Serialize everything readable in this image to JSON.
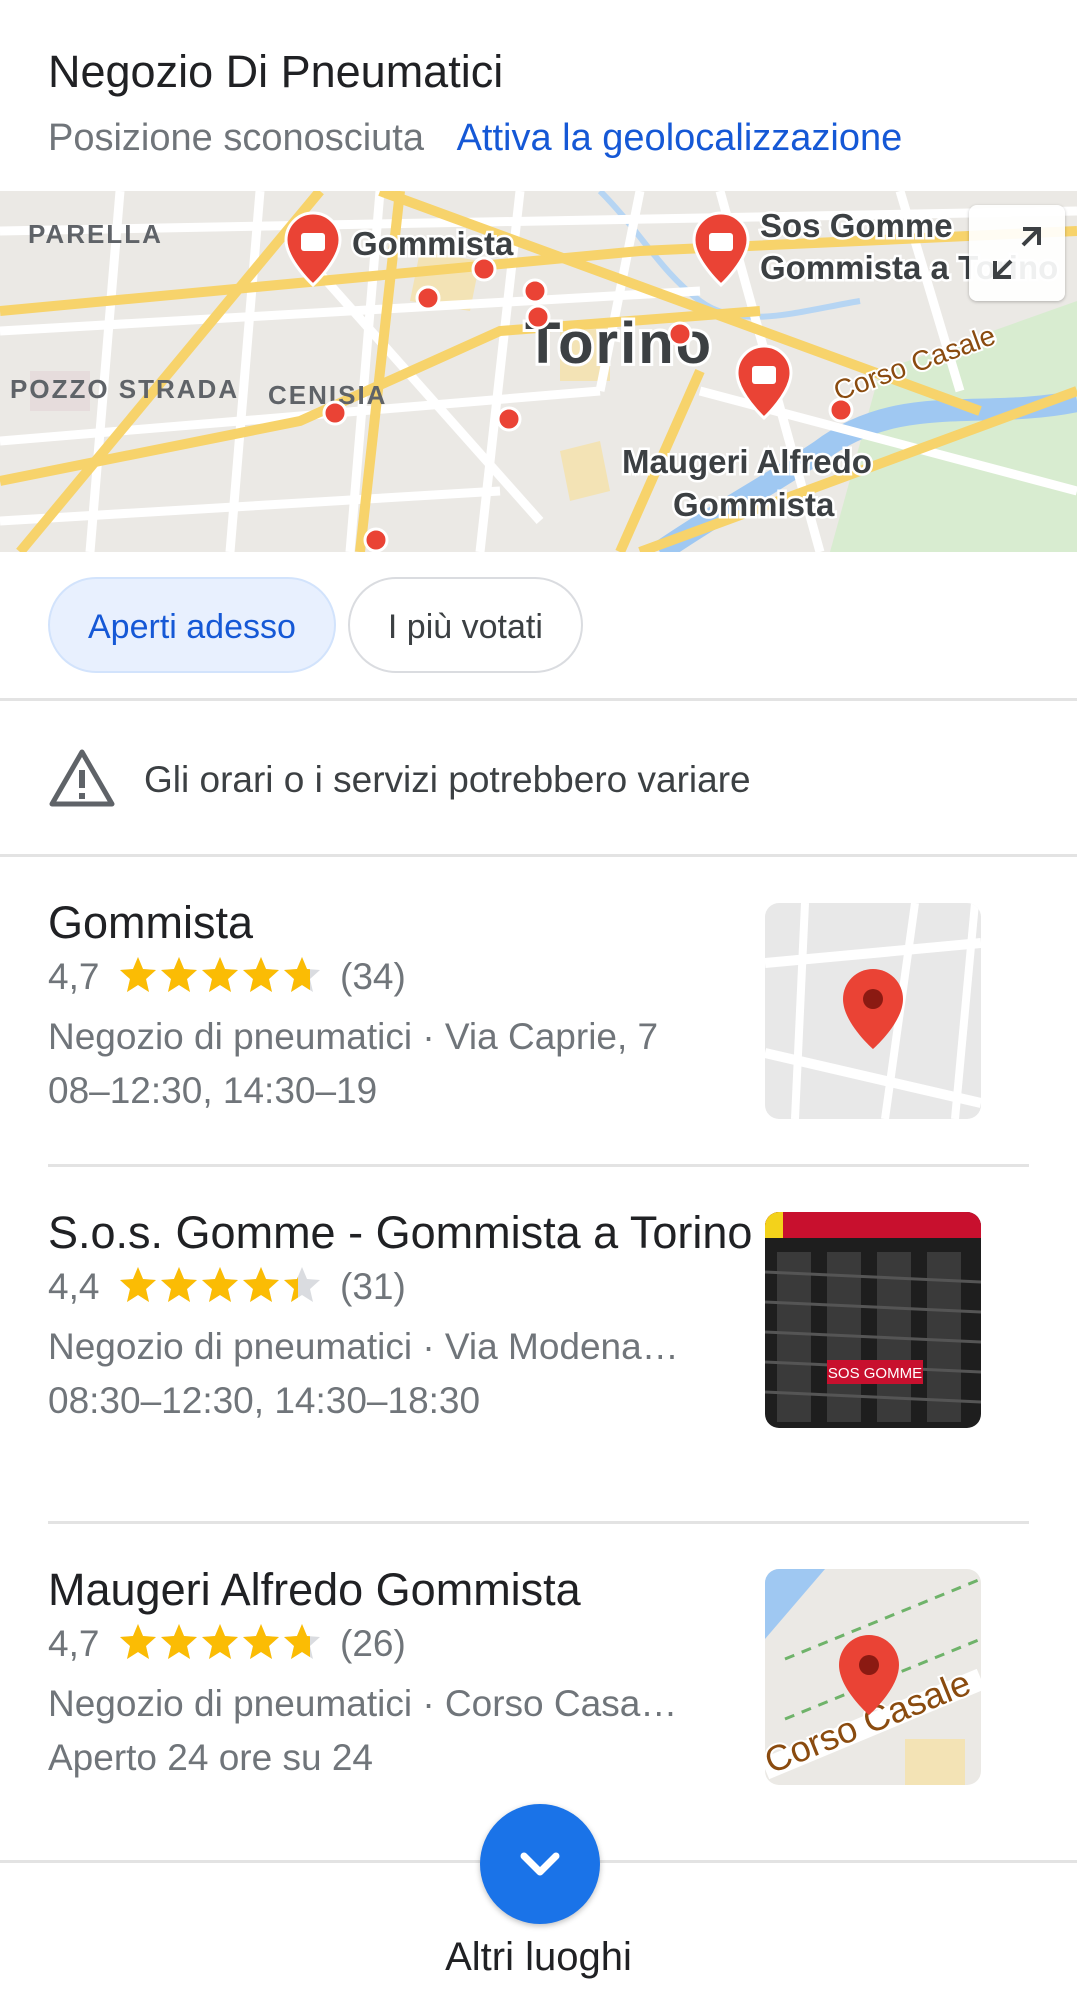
{
  "header": {
    "title": "Negozio Di Pneumatici",
    "location_status": "Posizione sconosciuta",
    "geolocation_link": "Attiva la geolocalizzazione"
  },
  "map": {
    "labels": {
      "parella": "PARELLA",
      "pozzo": "POZZO STRADA",
      "cenisia": "CENISIA",
      "city": "Torino",
      "corso_casale": "Corso Casale",
      "pin1": "Gommista",
      "pin2a": "Sos Gomme",
      "pin2b": "Gommista a Torino",
      "pin3a": "Maugeri Alfredo",
      "pin3b": "Gommista"
    },
    "road_color": "#f7d36b",
    "pin_color": "#ea4335"
  },
  "filters": {
    "open_now": "Aperti adesso",
    "top_rated": "I più votati"
  },
  "notice": "Gli orari o i servizi potrebbero variare",
  "places": [
    {
      "name": "Gommista",
      "rating": "4,7",
      "stars": 4.7,
      "reviews": "(34)",
      "details": "Negozio di pneumatici · Via Caprie, 7",
      "hours": "08–12:30, 14:30–19"
    },
    {
      "name": "S.o.s. Gomme - Gommista a Torino",
      "rating": "4,4",
      "stars": 4.4,
      "reviews": "(31)",
      "details": "Negozio di pneumatici · Via Modena…",
      "hours": "08:30–12:30, 14:30–18:30",
      "thumb_text": "SOS GOMME"
    },
    {
      "name": "Maugeri Alfredo Gommista",
      "rating": "4,7",
      "stars": 4.7,
      "reviews": "(26)",
      "details": "Negozio di pneumatici · Corso Casa…",
      "hours": "Aperto 24 ore su 24",
      "thumb_text": "Corso Casale"
    }
  ],
  "more": {
    "label": "Altri luoghi"
  },
  "colors": {
    "accent": "#1a73e8",
    "link": "#1558d6",
    "star": "#fbbc04"
  }
}
